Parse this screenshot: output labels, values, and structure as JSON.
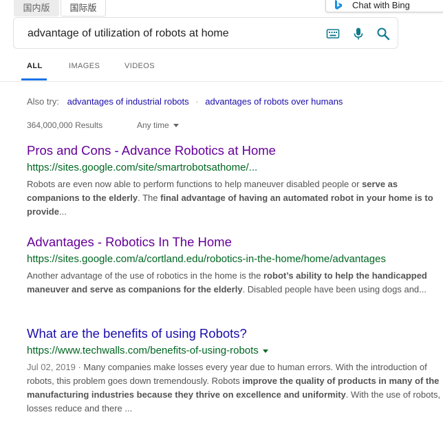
{
  "region_tabs": {
    "domestic": "国内版",
    "international": "国际版"
  },
  "chat_bing": {
    "label": "Chat with Bing",
    "icon": "bing-logo-icon"
  },
  "search": {
    "query": "advantage of utilization of robots at home",
    "icons": [
      "keyboard-icon",
      "microphone-icon",
      "search-icon"
    ]
  },
  "nav": {
    "tabs": [
      {
        "label": "ALL",
        "active": true
      },
      {
        "label": "IMAGES",
        "active": false
      },
      {
        "label": "VIDEOS",
        "active": false
      }
    ]
  },
  "also_try": {
    "label": "Also try:",
    "links": [
      "advantages of industrial robots",
      "advantages of robots over humans"
    ],
    "separator": "·"
  },
  "stats": {
    "count": "364,000,000 Results",
    "time_filter": "Any time"
  },
  "results": [
    {
      "title": "Pros and Cons - Advance Robotics at Home",
      "url": "https://sites.google.com/site/smartrobotsathome/...",
      "visited": true,
      "snippet": [
        {
          "text": "Robots are even now able to perform functions to help maneuver disabled people or ",
          "bold": false
        },
        {
          "text": "serve as companions to the elderly",
          "bold": true
        },
        {
          "text": ". The ",
          "bold": false
        },
        {
          "text": "final advantage of having an automated robot in your home is to provide",
          "bold": true
        },
        {
          "text": "...",
          "bold": false
        }
      ]
    },
    {
      "title": "Advantages - Robotics In The Home",
      "url": "https://sites.google.com/a/cortland.edu/robotics-in-the-home/home/advantages",
      "visited": true,
      "snippet": [
        {
          "text": "Another advantage of the use of robotics in the home is the ",
          "bold": false
        },
        {
          "text": "robot’s ability to help the handicapped maneuver and serve as companions for the elderly",
          "bold": true
        },
        {
          "text": ". Disabled people have been using dogs and...",
          "bold": false
        }
      ]
    },
    {
      "title": "What are the benefits of using Robots?",
      "url": "https://www.techwalls.com/benefits-of-using-robots",
      "visited": false,
      "date": "Jul 02, 2019 · ",
      "snippet": [
        {
          "text": "Many companies make losses every year due to human errors. With the introduction of robots, this problem goes down tremendously. Robots ",
          "bold": false
        },
        {
          "text": "improve the quality of products in many of the manufacturing industries because they thrive on excellence and uniformity",
          "bold": true
        },
        {
          "text": ". With the use of robots, losses reduce and there ...",
          "bold": false
        }
      ]
    }
  ],
  "colors": {
    "accent": "#1a73e8",
    "visited_link": "#660099",
    "link": "#1a0dab",
    "url_green": "#006621",
    "icon_teal": "#0e7a8c"
  }
}
